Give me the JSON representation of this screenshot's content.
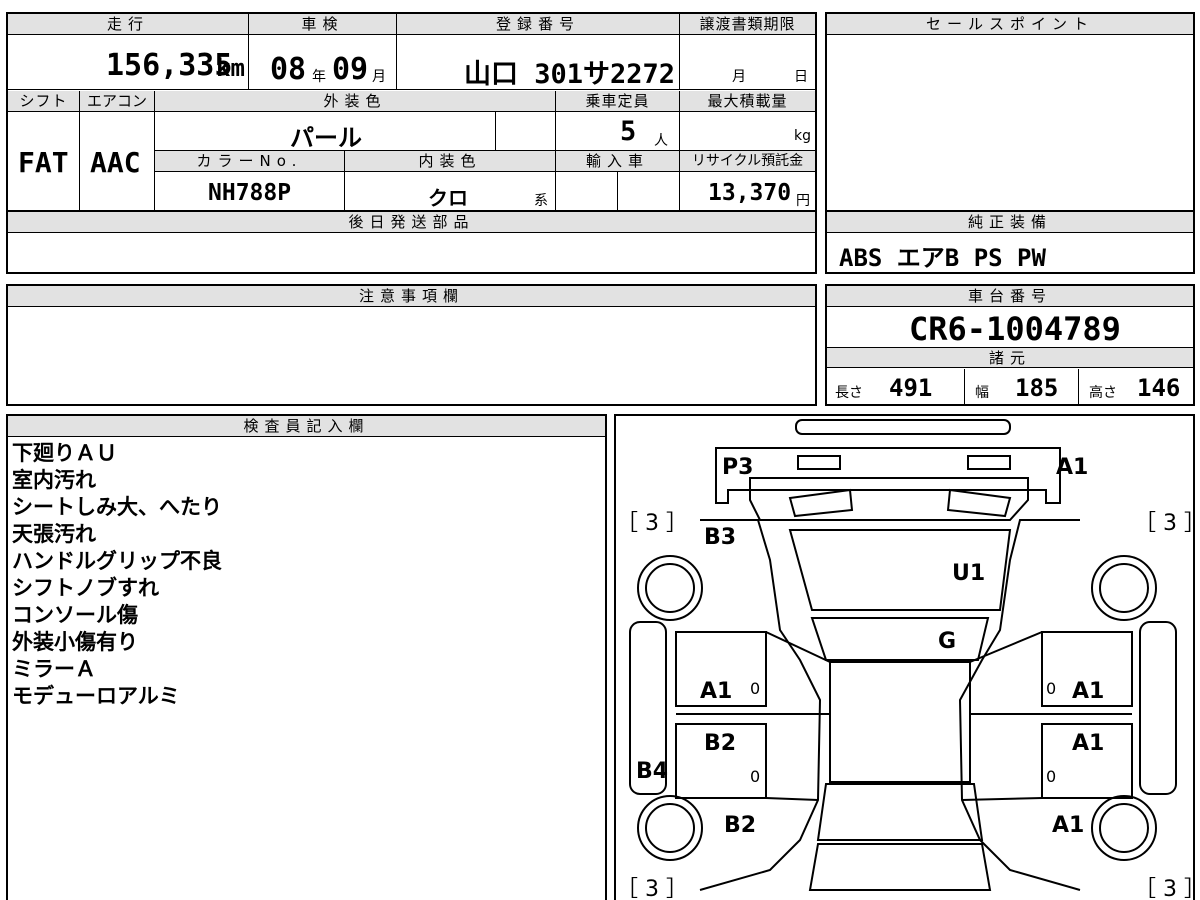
{
  "main_info": {
    "mileage_label": "走行",
    "mileage_value": "156,335",
    "mileage_unit": "km",
    "inspection_label": "車検",
    "inspection_year": "08",
    "inspection_year_unit": "年",
    "inspection_month": "09",
    "inspection_month_unit": "月",
    "registration_label": "登録番号",
    "registration_value": "山口 301サ2272",
    "transfer_deadline_label": "譲渡書類期限",
    "transfer_month_unit": "月",
    "transfer_day_unit": "日"
  },
  "spec_info": {
    "shift_label": "シフト",
    "shift_value": "FAT",
    "aircon_label": "エアコン",
    "aircon_value": "AAC",
    "exterior_color_label": "外装色",
    "exterior_color_value": "パール",
    "capacity_label": "乗車定員",
    "capacity_value": "5",
    "capacity_unit": "人",
    "max_load_label": "最大積載量",
    "max_load_unit": "kg",
    "color_no_label": "カラーNo.",
    "color_no_value": "NH788P",
    "interior_color_label": "内装色",
    "interior_color_value": "クロ",
    "interior_color_suffix": "系",
    "import_label": "輸入車",
    "recycle_fee_label": "リサイクル預託金",
    "recycle_fee_value": "13,370",
    "recycle_fee_unit": "円"
  },
  "later_parts": {
    "label": "後日発送部品"
  },
  "sale_points": {
    "label": "セールスポイント"
  },
  "standard_equipment": {
    "label": "純正装備",
    "value": "ABS エアB PS PW"
  },
  "caution": {
    "label": "注意事項欄"
  },
  "chassis": {
    "label": "車台番号",
    "value": "CR6-1004789"
  },
  "specs": {
    "label": "諸元",
    "length_label": "長さ",
    "length_value": "491",
    "width_label": "幅",
    "width_value": "185",
    "height_label": "高さ",
    "height_value": "146"
  },
  "inspector": {
    "label": "検査員記入欄",
    "notes": [
      "下廻りＡＵ",
      "室内汚れ",
      "シートしみ大、へたり",
      "天張汚れ",
      "ハンドルグリップ不良",
      "シフトノブすれ",
      "コンソール傷",
      "外装小傷有り",
      "ミラーＡ",
      "モデューロアルミ"
    ]
  },
  "diagram": {
    "p3": "P3",
    "a1_top_right": "A1",
    "tire_tl": "［ 3 ］",
    "tire_tr": "［ 3 ］",
    "tire_bl": "［ 3 ］",
    "tire_br": "［ 3 ］",
    "b3": "B3",
    "u1": "U1",
    "g": "G",
    "a1_left_front_door": "A1",
    "a1_right_front_door": "A1",
    "b2_left_rear_door": "B2",
    "a1_right_rear_door": "A1",
    "b4": "B4",
    "b2_left_rear_fender": "B2",
    "a1_right_rear_fender": "A1",
    "zero": "0"
  }
}
